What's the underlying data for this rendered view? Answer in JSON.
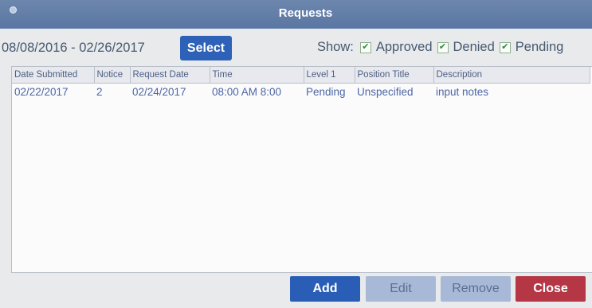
{
  "window": {
    "title": "Requests"
  },
  "filter": {
    "date_range": "08/08/2016 - 02/26/2017",
    "select_label": "Select",
    "show_label": "Show:",
    "checkboxes": [
      {
        "label": "Approved",
        "checked": true
      },
      {
        "label": "Denied",
        "checked": true
      },
      {
        "label": "Pending",
        "checked": true
      }
    ]
  },
  "table": {
    "columns": [
      "Date Submitted",
      "Notice",
      "Request Date",
      "Time",
      "Level 1",
      "Position Title",
      "Description"
    ],
    "rows": [
      [
        "02/22/2017",
        "2",
        "02/24/2017",
        "08:00 AM 8:00",
        "Pending",
        "Unspecified",
        "input notes"
      ]
    ]
  },
  "buttons": {
    "add": "Add",
    "edit": "Edit",
    "remove": "Remove",
    "close": "Close"
  },
  "colors": {
    "titlebar": "#5f7aa6",
    "primary": "#2e62b8",
    "disabled": "#a7b9d6",
    "danger": "#b53645",
    "check": "#2c8a3a"
  },
  "icons": {
    "checkbox_mark": "✔"
  }
}
